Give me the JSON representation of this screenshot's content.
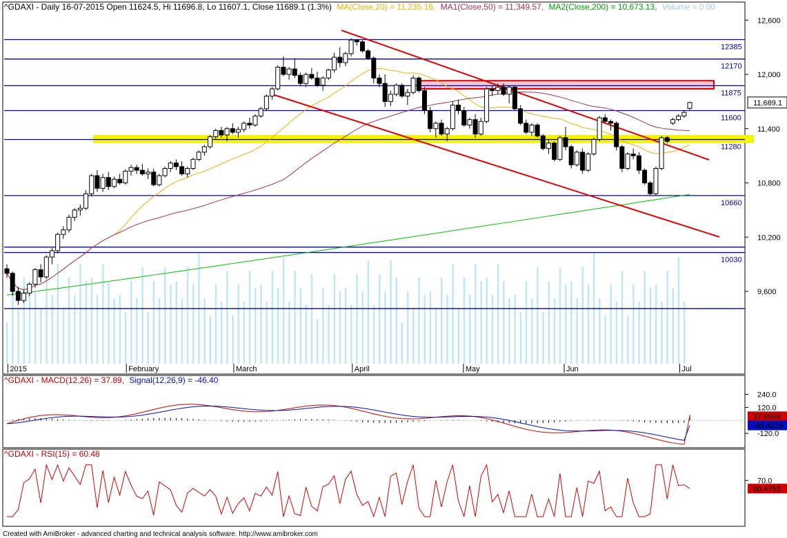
{
  "header": {
    "symbol": "^GDAXI",
    "line": "^GDAXI - Daily 16-07-2015 Open 11624.5, Hi 11696.8, Lo 11607.1, Close 11689.1 (1.3%)",
    "ma20": "MA(Close,20) = 11,235.16,",
    "ma50": "MA1(Close,50) = 11,349.57,",
    "ma200": "MA2(Close,200) = 10,673.13,",
    "volume": "Volume = 0.00",
    "macd": "^GDAXI - MACD(12,26) = 37.89,",
    "signal": "Signal(12,26,9) = -46.40",
    "rsi": "^GDAXI - RSI(15) = 60.48"
  },
  "footer": "Created with AmiBroker - advanced charting and technical analysis software. http://www.amibroker.com",
  "colors": {
    "bg": "#ffffff",
    "levels": "#0000c0",
    "trend": "#e00000",
    "ma20": "#f0b000",
    "ma50": "#a0305a",
    "ma200": "#00c000",
    "volume": "#bfe6f5",
    "macd": "#d00000",
    "signal": "#0010c0",
    "rsi": "#d00000",
    "yellowZone": "#f4f400",
    "resistanceZone": "#f4c7d7"
  },
  "chart_data": [
    {
      "type": "candlestick",
      "title": "^GDAXI - Daily 16-07-2015",
      "ylim": [
        8800,
        12800
      ],
      "yticks": [
        "12,600",
        "12,000",
        "11,400",
        "10,800",
        "10,200",
        "9,600"
      ],
      "xtick_labels": [
        "2015",
        "February",
        "March",
        "April",
        "May",
        "Jun",
        "Jul"
      ],
      "last_value_label": "11,689.1",
      "horizontal_levels": [
        12385,
        12170,
        11875,
        11600,
        11280,
        10660,
        10030
      ],
      "level_labels": [
        "12385",
        "12170",
        "11875",
        "11600",
        "11280",
        "10660",
        "10030"
      ],
      "zones": [
        {
          "name": "support",
          "low": 11240,
          "high": 11330
        },
        {
          "name": "resistance",
          "low": 11840,
          "high": 11930
        }
      ],
      "ohlc_approx": [
        [
          9850,
          9900,
          9750,
          9800
        ],
        [
          9800,
          9820,
          9550,
          9600
        ],
        [
          9600,
          9650,
          9450,
          9500
        ],
        [
          9500,
          9620,
          9470,
          9580
        ],
        [
          9580,
          9700,
          9550,
          9680
        ],
        [
          9680,
          9860,
          9640,
          9840
        ],
        [
          9840,
          9900,
          9700,
          9760
        ],
        [
          9760,
          10000,
          9740,
          9980
        ],
        [
          9980,
          10080,
          9900,
          10050
        ],
        [
          10050,
          10250,
          10020,
          10230
        ],
        [
          10230,
          10320,
          10180,
          10280
        ],
        [
          10280,
          10450,
          10250,
          10420
        ],
        [
          10420,
          10520,
          10380,
          10500
        ],
        [
          10500,
          10560,
          10440,
          10520
        ],
        [
          10520,
          10720,
          10500,
          10680
        ],
        [
          10680,
          10900,
          10650,
          10880
        ],
        [
          10880,
          10940,
          10700,
          10740
        ],
        [
          10740,
          10900,
          10700,
          10860
        ],
        [
          10860,
          10920,
          10720,
          10760
        ],
        [
          10760,
          10870,
          10740,
          10840
        ],
        [
          10840,
          10900,
          10780,
          10800
        ],
        [
          10800,
          10950,
          10780,
          10930
        ],
        [
          10930,
          11000,
          10880,
          10970
        ],
        [
          10970,
          11000,
          10900,
          10940
        ],
        [
          10940,
          11010,
          10880,
          10900
        ],
        [
          10900,
          10960,
          10840,
          10920
        ],
        [
          10920,
          10960,
          10760,
          10780
        ],
        [
          10780,
          10900,
          10760,
          10880
        ],
        [
          10880,
          10980,
          10860,
          10960
        ],
        [
          10960,
          11040,
          10920,
          11020
        ],
        [
          11020,
          11060,
          10940,
          10980
        ],
        [
          10980,
          11040,
          10880,
          10900
        ],
        [
          10900,
          10980,
          10860,
          10960
        ],
        [
          10960,
          11080,
          10940,
          11060
        ],
        [
          11060,
          11160,
          11040,
          11140
        ],
        [
          11140,
          11220,
          11100,
          11200
        ],
        [
          11200,
          11330,
          11180,
          11310
        ],
        [
          11310,
          11400,
          11280,
          11380
        ],
        [
          11380,
          11420,
          11300,
          11330
        ],
        [
          11330,
          11420,
          11260,
          11400
        ],
        [
          11400,
          11460,
          11340,
          11360
        ],
        [
          11360,
          11420,
          11300,
          11390
        ],
        [
          11390,
          11480,
          11360,
          11460
        ],
        [
          11460,
          11520,
          11400,
          11440
        ],
        [
          11440,
          11560,
          11420,
          11540
        ],
        [
          11540,
          11640,
          11520,
          11620
        ],
        [
          11620,
          11780,
          11600,
          11760
        ],
        [
          11760,
          11860,
          11720,
          11840
        ],
        [
          11840,
          12100,
          11820,
          12080
        ],
        [
          12080,
          12200,
          11980,
          12000
        ],
        [
          12000,
          12080,
          11940,
          12060
        ],
        [
          12060,
          12180,
          11960,
          11990
        ],
        [
          11990,
          12020,
          11880,
          11900
        ],
        [
          11900,
          12020,
          11860,
          12000
        ],
        [
          12000,
          12070,
          11940,
          11960
        ],
        [
          11960,
          12030,
          11860,
          11880
        ],
        [
          11880,
          11980,
          11820,
          11960
        ],
        [
          11960,
          12060,
          11940,
          12050
        ],
        [
          12050,
          12240,
          12020,
          12190
        ],
        [
          12190,
          12300,
          12080,
          12130
        ],
        [
          12130,
          12250,
          12090,
          12230
        ],
        [
          12230,
          12400,
          12200,
          12380
        ],
        [
          12380,
          12390,
          12320,
          12360
        ],
        [
          12360,
          12380,
          12240,
          12260
        ],
        [
          12260,
          12280,
          12160,
          12180
        ],
        [
          12180,
          12200,
          11900,
          11960
        ],
        [
          11960,
          12000,
          11860,
          11900
        ],
        [
          11900,
          12000,
          11640,
          11700
        ],
        [
          11700,
          11820,
          11650,
          11780
        ],
        [
          11780,
          11900,
          11760,
          11880
        ],
        [
          11880,
          11900,
          11740,
          11760
        ],
        [
          11760,
          11840,
          11660,
          11800
        ],
        [
          11800,
          11990,
          11780,
          11960
        ],
        [
          11960,
          11980,
          11800,
          11820
        ],
        [
          11820,
          11860,
          11560,
          11600
        ],
        [
          11600,
          11640,
          11360,
          11400
        ],
        [
          11400,
          11480,
          11300,
          11460
        ],
        [
          11460,
          11500,
          11320,
          11340
        ],
        [
          11340,
          11420,
          11260,
          11400
        ],
        [
          11400,
          11700,
          11380,
          11660
        ],
        [
          11660,
          11720,
          11560,
          11600
        ],
        [
          11600,
          11640,
          11420,
          11440
        ],
        [
          11440,
          11520,
          11400,
          11500
        ],
        [
          11500,
          11560,
          11300,
          11340
        ],
        [
          11340,
          11520,
          11320,
          11480
        ],
        [
          11480,
          11860,
          11460,
          11840
        ],
        [
          11840,
          11880,
          11760,
          11820
        ],
        [
          11820,
          11900,
          11780,
          11860
        ],
        [
          11860,
          11900,
          11760,
          11780
        ],
        [
          11780,
          11880,
          11680,
          11860
        ],
        [
          11860,
          11880,
          11600,
          11620
        ],
        [
          11620,
          11660,
          11440,
          11460
        ],
        [
          11460,
          11500,
          11340,
          11360
        ],
        [
          11360,
          11460,
          11320,
          11440
        ],
        [
          11440,
          11460,
          11300,
          11320
        ],
        [
          11320,
          11340,
          11160,
          11180
        ],
        [
          11180,
          11280,
          11120,
          11240
        ],
        [
          11240,
          11260,
          11040,
          11060
        ],
        [
          11060,
          11320,
          11040,
          11300
        ],
        [
          11300,
          11420,
          11160,
          11200
        ],
        [
          11200,
          11220,
          10960,
          11000
        ],
        [
          11000,
          11160,
          10980,
          11140
        ],
        [
          11140,
          11180,
          10900,
          10940
        ],
        [
          10940,
          11140,
          10920,
          11120
        ],
        [
          11120,
          11300,
          11100,
          11280
        ],
        [
          11280,
          11540,
          11260,
          11520
        ],
        [
          11520,
          11560,
          11460,
          11480
        ],
        [
          11480,
          11500,
          11380,
          11460
        ],
        [
          11460,
          11480,
          11160,
          11200
        ],
        [
          11200,
          11220,
          10920,
          10960
        ],
        [
          10960,
          11140,
          10940,
          11120
        ],
        [
          11120,
          11180,
          11060,
          11100
        ],
        [
          11100,
          11140,
          10900,
          10940
        ],
        [
          10940,
          10960,
          10780,
          10800
        ],
        [
          10800,
          10820,
          10660,
          10680
        ],
        [
          10680,
          10980,
          10660,
          10960
        ],
        [
          10960,
          11320,
          10940,
          11300
        ],
        [
          11300,
          11320,
          11240,
          11260
        ],
        [
          11460,
          11520,
          11440,
          11500
        ],
        [
          11500,
          11560,
          11480,
          11540
        ],
        [
          11540,
          11600,
          11520,
          11580
        ],
        [
          11624.5,
          11696.8,
          11607.1,
          11689.1
        ]
      ]
    },
    {
      "type": "line",
      "title": "^GDAXI - MACD(12,26) = 37.89, Signal(12,26,9) = -46.40",
      "ylim": [
        -240,
        320
      ],
      "yticks": [
        "240.0",
        "120.0",
        "-120.0"
      ],
      "series": [
        {
          "name": "MACD(12,26)",
          "last": 37.8909
        },
        {
          "name": "Signal(12,26,9)",
          "last": -46.4019
        }
      ],
      "value_labels": [
        "37.8909",
        "-46.4019"
      ]
    },
    {
      "type": "line",
      "title": "^GDAXI - RSI(15) = 60.48",
      "ylim": [
        20,
        95
      ],
      "yticks": [
        "70.0"
      ],
      "series": [
        {
          "name": "RSI(15)",
          "last": 60.4753
        }
      ],
      "value_labels": [
        "60.4753"
      ]
    }
  ]
}
